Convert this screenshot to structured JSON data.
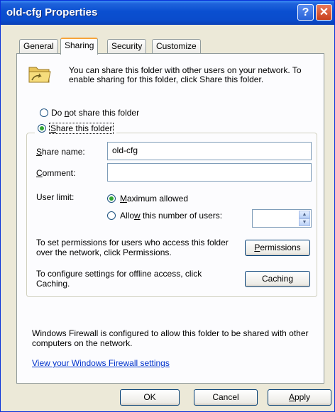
{
  "window": {
    "title": "old-cfg Properties",
    "help_glyph": "?",
    "close_glyph": "✕"
  },
  "tabs": [
    {
      "label": "General"
    },
    {
      "label": "Sharing"
    },
    {
      "label": "Security"
    },
    {
      "label": "Customize"
    }
  ],
  "sharing": {
    "intro": "You can share this folder with other users on your network.  To enable sharing for this folder, click Share this folder.",
    "do_not_share": {
      "label_u": "Do ",
      "label_key": "n",
      "label_rest": "ot share this folder",
      "selected": false
    },
    "share_this": {
      "label_key": "S",
      "label_rest": "hare this folder",
      "selected": true
    },
    "share_name": {
      "label_key": "S",
      "label_rest": "hare name:",
      "value": "old-cfg"
    },
    "comment": {
      "label_key": "C",
      "label_rest": "omment:",
      "value": ""
    },
    "user_limit": {
      "label": "User limit:",
      "maximum_allowed": {
        "label_key": "M",
        "label_rest": "aximum allowed",
        "selected": true
      },
      "allow_number": {
        "label_a": "Allo",
        "label_key": "w",
        "label_rest": " this number of users:",
        "selected": false,
        "value": ""
      }
    },
    "permissions_text": "To set permissions for users who access this folder over the network, click Permissions.",
    "permissions_button": {
      "label_key": "P",
      "label_rest": "ermissions"
    },
    "caching_text": "To configure settings for offline access, click Caching.",
    "caching_button": "Caching",
    "firewall_text": "Windows Firewall is configured to allow this folder to be shared with other computers on the network.",
    "firewall_link": "View your Windows Firewall settings"
  },
  "footer": {
    "ok": "OK",
    "cancel": "Cancel",
    "apply_key": "A",
    "apply_rest": "pply"
  },
  "colors": {
    "title_bar": "#0a4ccc",
    "dialog_bg": "#ece9d8",
    "active_tab_accent": "#f7a43a",
    "link": "#0033cc"
  }
}
